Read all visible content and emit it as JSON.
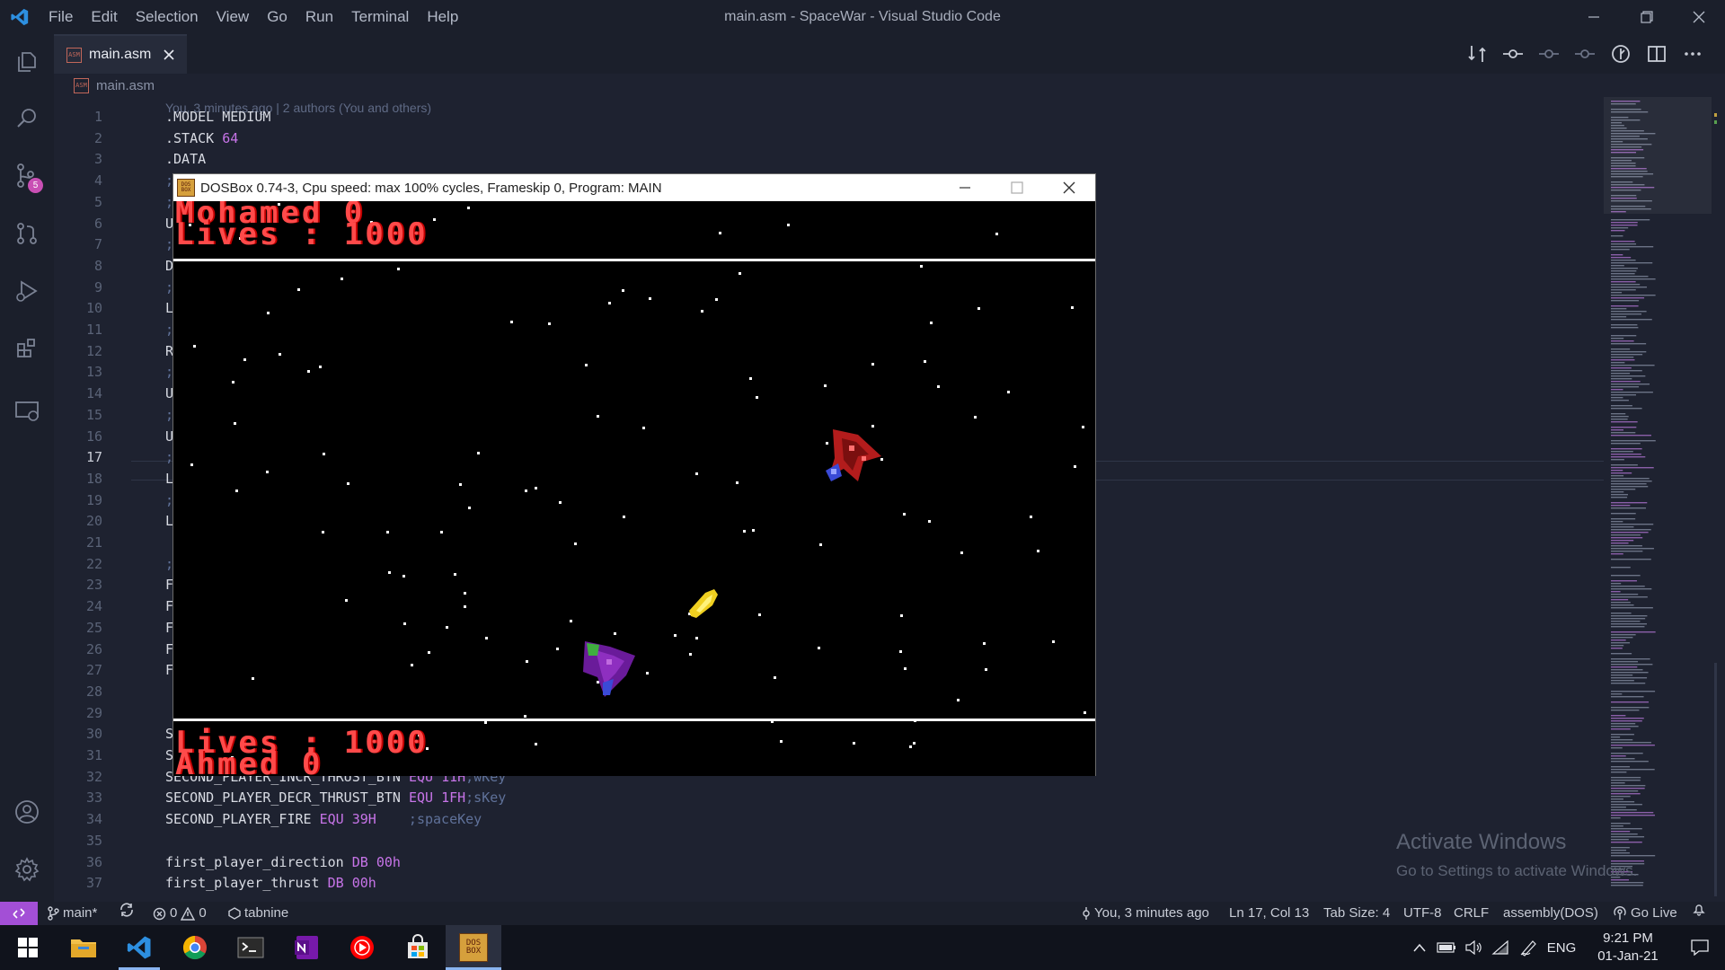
{
  "window": {
    "title": "main.asm - SpaceWar - Visual Studio Code"
  },
  "menu": [
    "File",
    "Edit",
    "Selection",
    "View",
    "Go",
    "Run",
    "Terminal",
    "Help"
  ],
  "activity_bar": {
    "scm_badge": "5"
  },
  "tab": {
    "label": "main.asm"
  },
  "breadcrumb": {
    "file": "main.asm"
  },
  "file_icon_text": "ASM",
  "editor": {
    "blame": "You, 3 minutes ago | 2 authors (You and others)",
    "line_numbers": [
      "1",
      "2",
      "3",
      "4",
      "5",
      "6",
      "7",
      "8",
      "9",
      "10",
      "11",
      "12",
      "13",
      "14",
      "15",
      "16",
      "17",
      "18",
      "19",
      "20",
      "21",
      "22",
      "23",
      "24",
      "25",
      "26",
      "27",
      "28",
      "29",
      "30",
      "31",
      "32",
      "33",
      "34",
      "35",
      "36",
      "37"
    ],
    "active_line": "17",
    "lines": [
      ".MODEL MEDIUM",
      ".STACK 64",
      ".DATA",
      ";",
      ";",
      "U",
      ";",
      "D",
      ";",
      "L",
      ";",
      "R",
      ";",
      "U",
      ";",
      "U",
      ";",
      "L",
      ";",
      "L",
      "",
      ";",
      "F",
      "F",
      "F",
      "F",
      "F",
      "",
      "",
      "S",
      "S",
      "SECOND_PLAYER_INCR_THRUST_BTN EQU 11H;wKey",
      "SECOND_PLAYER_DECR_THRUST_BTN EQU 1FH;sKey",
      "SECOND_PLAYER_FIRE EQU 39H    ;spaceKey",
      "",
      "first_player_direction DB 00h",
      "first_player_thrust DB 00h"
    ],
    "code_tokens": {
      "stack_kw": ".STACK",
      "stack_val": "64",
      "l32_name": "SECOND_PLAYER_INCR_THRUST_BTN",
      "l32_kw": "EQU",
      "l32_val": "11H",
      "l32_cm": ";wKey",
      "l33_name": "SECOND_PLAYER_DECR_THRUST_BTN",
      "l33_kw": "EQU",
      "l33_val": "1FH",
      "l33_cm": ";sKey",
      "l34_name": "SECOND_PLAYER_FIRE",
      "l34_kw": "EQU",
      "l34_val": "39H",
      "l34_cm": ";spaceKey",
      "l36_name": "first_player_direction",
      "l36_kw": "DB",
      "l36_val": "00h",
      "l37_name": "first_player_thrust",
      "l37_kw": "DB",
      "l37_val": "00h"
    }
  },
  "dosbox": {
    "title": "DOSBox 0.74-3, Cpu speed: max 100% cycles, Frameskip  0, Program:    MAIN",
    "icon_text": "DOS BOX",
    "hud_top_name": "Mohamed 0",
    "hud_top_lives": "Lives : 1000",
    "hud_bottom_lives": "Lives : 1000",
    "hud_bottom_name": "Ahmed   0"
  },
  "watermark": {
    "title": "Activate Windows",
    "subtitle": "Go to Settings to activate Windows."
  },
  "statusbar": {
    "branch": "main*",
    "errors": "0",
    "warnings": "0",
    "tabnine": "tabnine",
    "blame": "You, 3 minutes ago",
    "position": "Ln 17, Col 13",
    "tab_size": "Tab Size: 4",
    "encoding": "UTF-8",
    "eol": "CRLF",
    "language": "assembly(DOS)",
    "go_live": "Go Live"
  },
  "taskbar": {
    "lang": "ENG",
    "time": "9:21 PM",
    "date": "01-Jan-21",
    "apps": [
      "file-explorer-icon",
      "vscode-icon",
      "chrome-icon",
      "terminal-icon",
      "onenote-icon",
      "youtube-music-icon",
      "store-icon",
      "dosbox-icon"
    ]
  },
  "colors": {
    "accent": "#a34fd6",
    "hud_red": "#ff4a4a",
    "keyword": "#c774e8"
  }
}
